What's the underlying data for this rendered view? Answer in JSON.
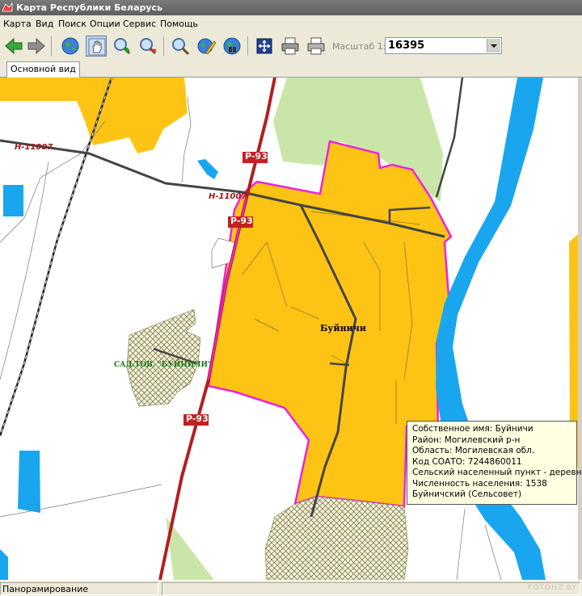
{
  "window": {
    "title": "Карта Республики Беларусь"
  },
  "menu": [
    "Карта",
    "Вид",
    "Поиск",
    "Опции",
    "Сервис",
    "Помощь"
  ],
  "toolbar": {
    "buttons": [
      "back-arrow-icon",
      "forward-arrow-icon",
      "globe-icon",
      "pan-hand-icon",
      "zoom-in-icon",
      "zoom-out-icon",
      "search-magnifier-icon",
      "globe-pencil-icon",
      "globe-binoculars-icon",
      "extent-icon",
      "print-icon",
      "print-preview-icon"
    ],
    "active_tool": "pan-hand-icon",
    "scale_label": "Масштаб 1:",
    "scale_value": "16395"
  },
  "tabs": [
    {
      "label": "Основной вид",
      "active": true
    }
  ],
  "map": {
    "road_labels": {
      "r93_a": "P-93",
      "r93_b": "P-93",
      "r93_c": "P-93",
      "h11007_a": "H-11007",
      "h11007_b": "H-11007"
    },
    "settlement_label": "Буйничи",
    "garden_label": "САД.ТОВ. \"БУЙНИЧИ\"",
    "colors": {
      "settlement": "#fec415",
      "boundary": "#ee22dd",
      "water": "#1aa6ee",
      "forest": "#c9e6a8",
      "road": "#b21f1f",
      "street": "#444444"
    }
  },
  "infobox": {
    "lines": [
      "Собственное имя: Буйничи",
      "Район: Могилевский р-н",
      "Область: Могилевская обл.",
      "Код СОАТО: 7244860011",
      "Сельский населенный пункт - деревня",
      "Численность населения: 1538",
      "Буйничский (Сельсовет)"
    ]
  },
  "status": {
    "mode": "Панорамирование",
    "watermark": "FOTOHZ.BY"
  }
}
